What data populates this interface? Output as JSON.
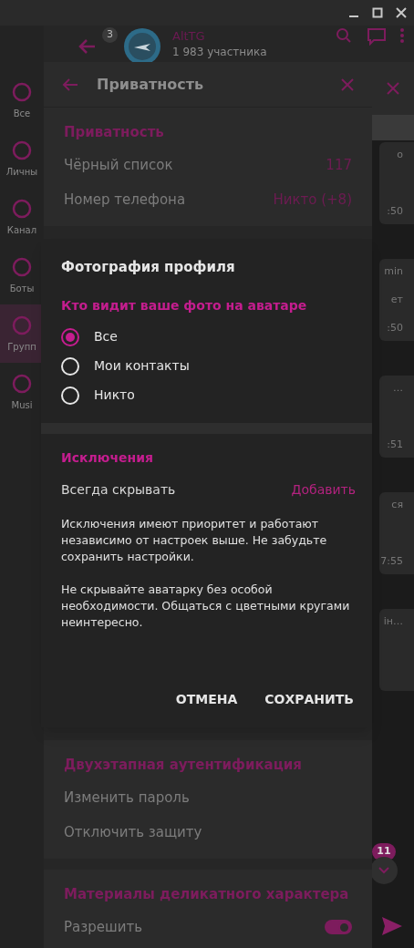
{
  "header": {
    "unread_badge": "3",
    "chat_title": "AltTG",
    "members": "1 983 участника"
  },
  "folders": [
    {
      "label": "Все",
      "selected": false
    },
    {
      "label": "Личны",
      "selected": false
    },
    {
      "label": "Канал",
      "selected": false
    },
    {
      "label": "Боты",
      "selected": false
    },
    {
      "label": "Групп",
      "selected": true
    },
    {
      "label": "Musi",
      "selected": false
    }
  ],
  "chat_bubbles": [
    {
      "top": "о",
      "bottom": ":50"
    },
    {
      "top": "min",
      "bottom": ":50",
      "middle": "ет"
    },
    {
      "top": "…",
      "bottom": ":51"
    },
    {
      "top": "ся",
      "bottom": "7:55"
    },
    {
      "top": "ін…"
    }
  ],
  "scroll_badge": "11",
  "privacy_panel": {
    "title": "Приватность",
    "sections": [
      {
        "title": "Приватность",
        "rows": [
          {
            "kind": "value",
            "label": "Чёрный список",
            "value": "117"
          },
          {
            "kind": "value",
            "label": "Номер телефона",
            "value": "Никто (+8)"
          }
        ]
      },
      {
        "title": "Двухэтапная аутентификация",
        "rows": [
          {
            "kind": "plain",
            "label": "Изменить пароль"
          },
          {
            "kind": "plain",
            "label": "Отключить защиту"
          }
        ]
      },
      {
        "title": "Материалы деликатного характера",
        "rows": [
          {
            "kind": "toggle",
            "label": "Разрешить",
            "on": true
          }
        ]
      }
    ]
  },
  "dialog": {
    "title": "Фотография профиля",
    "subtitle": "Кто видит ваше фото на аватаре",
    "options": [
      {
        "label": "Все",
        "selected": true
      },
      {
        "label": "Мои контакты",
        "selected": false
      },
      {
        "label": "Никто",
        "selected": false
      }
    ],
    "exceptions": {
      "title": "Исключения",
      "label": "Всегда скрывать",
      "action": "Добавить",
      "notes": [
        "Исключения имеют приоритет и работают независимо от настроек выше. Не забудьте сохранить настройки.",
        "Не скрывайте аватарку без особой необходимости. Общаться с цветными кругами неинтересно."
      ]
    },
    "buttons": [
      "ОТМЕНА",
      "СОХРАНИТЬ"
    ]
  }
}
